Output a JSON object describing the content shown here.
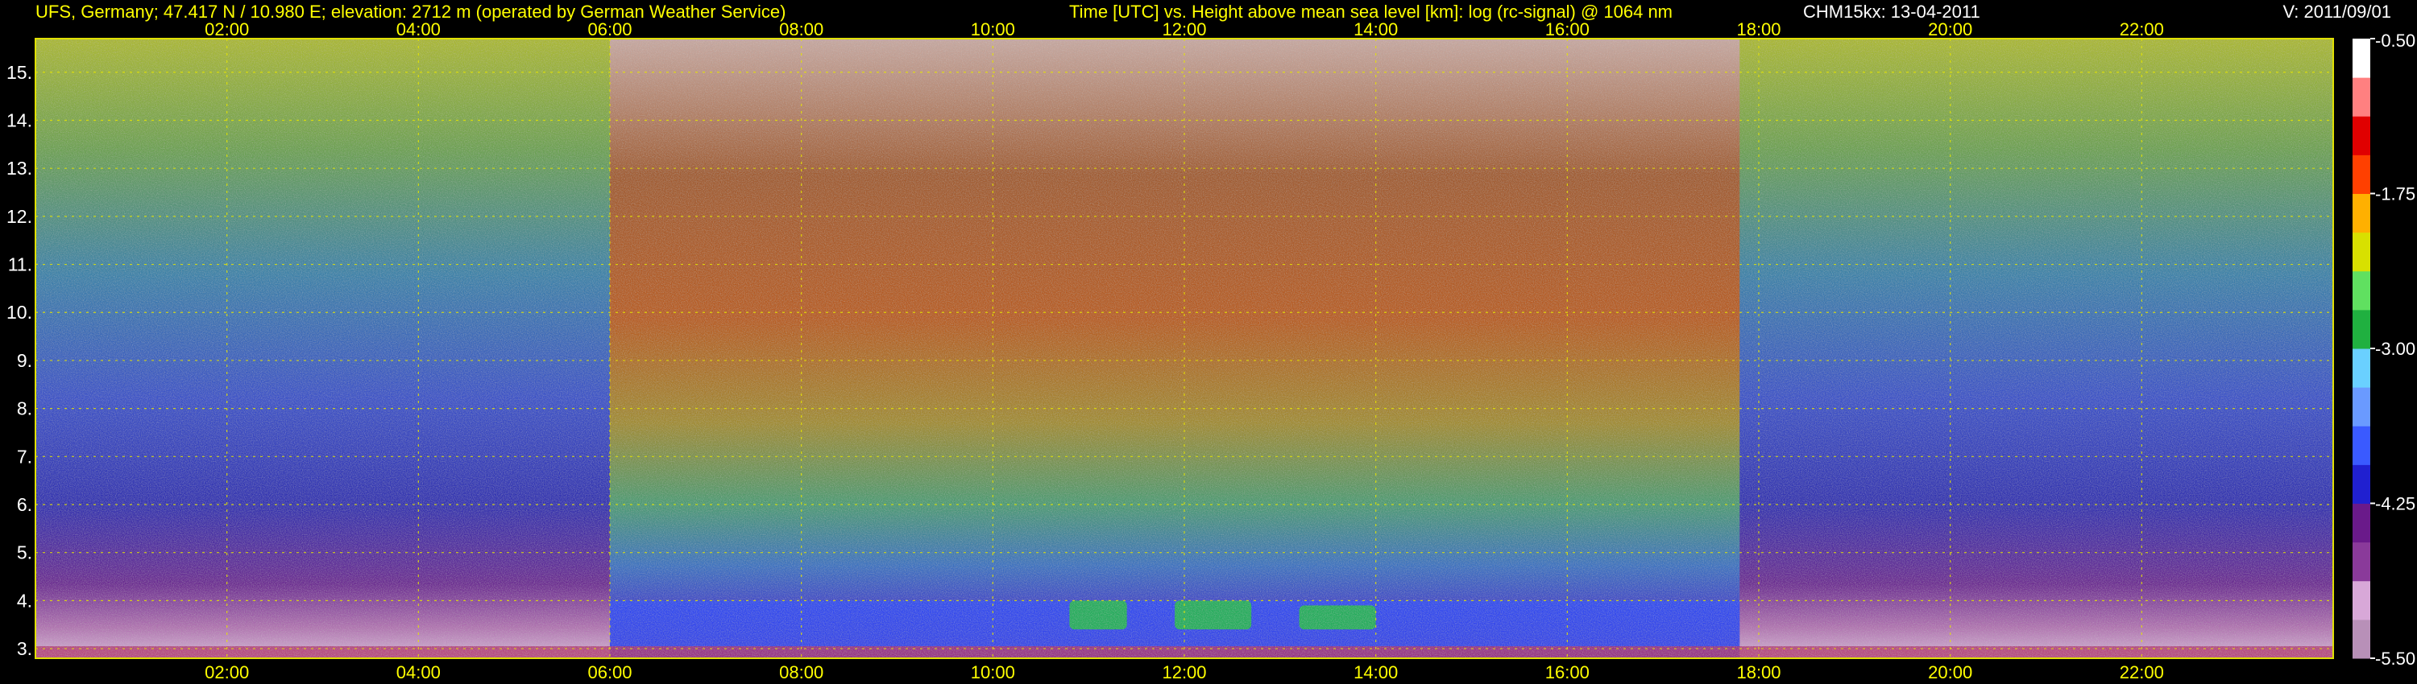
{
  "header": {
    "station": "UFS, Germany; 47.417 N / 10.980 E; elevation: 2712 m  (operated by German Weather Service)",
    "description": "Time [UTC] vs. Height above mean sea level [km]: log (rc-signal) @ 1064 nm",
    "instrument_date": "CHM15kx: 13-04-2011",
    "version": "V: 2011/09/01"
  },
  "chart_data": {
    "type": "heatmap",
    "title": "Time [UTC] vs. Height above mean sea level [km]: log (rc-signal) @ 1064 nm",
    "xlabel": "Time [UTC]",
    "ylabel": "Height above mean sea level [km]",
    "xlim": [
      0,
      24
    ],
    "ylim": [
      2.8,
      15.7
    ],
    "x_ticks": [
      2,
      4,
      6,
      8,
      10,
      12,
      14,
      16,
      18,
      20,
      22
    ],
    "x_tick_labels": [
      "02:00",
      "04:00",
      "06:00",
      "08:00",
      "10:00",
      "12:00",
      "14:00",
      "16:00",
      "18:00",
      "20:00",
      "22:00"
    ],
    "y_ticks": [
      3,
      4,
      5,
      6,
      7,
      8,
      9,
      10,
      11,
      12,
      13,
      14,
      15
    ],
    "y_tick_labels": [
      "3.",
      "4.",
      "5.",
      "6.",
      "7.",
      "8.",
      "9.",
      "10.",
      "11.",
      "12.",
      "13.",
      "14.",
      "15."
    ],
    "grid": true,
    "colorbar": {
      "range": [
        -5.5,
        -0.5
      ],
      "ticks": [
        -0.5,
        -1.75,
        -3.0,
        -4.25,
        -5.5
      ],
      "tick_labels": [
        "-0.50",
        "-1.75",
        "-3.00",
        "-4.25",
        "-5.50"
      ],
      "colors": [
        "#b890b8",
        "#d8a8d8",
        "#8a3a9a",
        "#6a1a8a",
        "#2020d0",
        "#3a5aff",
        "#6a9aff",
        "#6ad0ff",
        "#20b040",
        "#60e060",
        "#d8e000",
        "#ffb000",
        "#ff4000",
        "#e00000",
        "#ff8080",
        "#ffffff"
      ]
    },
    "day_period_hours": [
      6.0,
      17.8
    ],
    "boundary_layer_top_km": 4.0,
    "cloud_segments": [
      {
        "start_hour": 10.8,
        "end_hour": 11.4,
        "base_km": 3.4,
        "top_km": 4.0
      },
      {
        "start_hour": 11.9,
        "end_hour": 12.7,
        "base_km": 3.4,
        "top_km": 4.0
      },
      {
        "start_hour": 13.2,
        "end_hour": 14.0,
        "base_km": 3.4,
        "top_km": 3.9
      }
    ]
  }
}
